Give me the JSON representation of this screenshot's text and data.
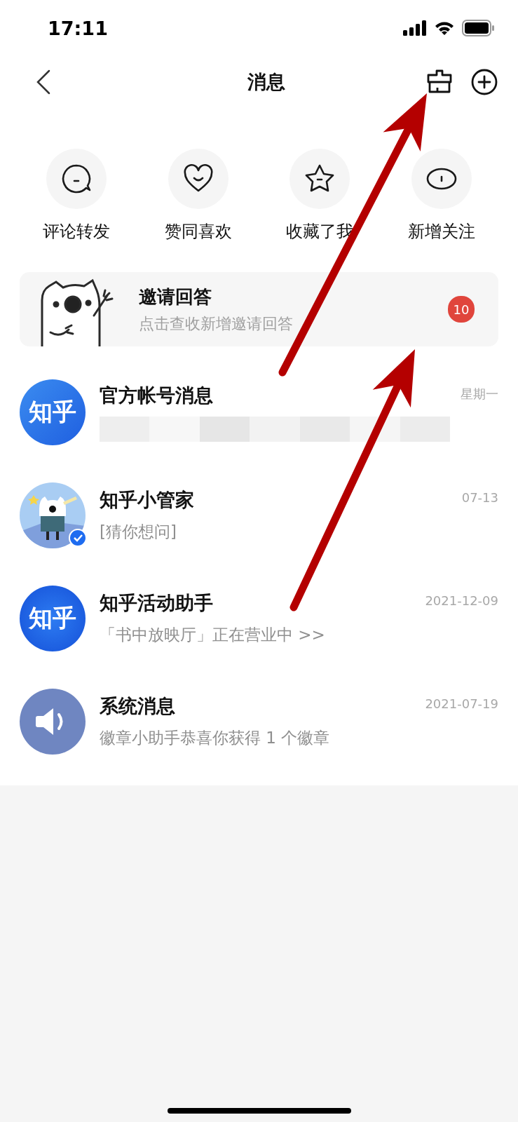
{
  "status_bar": {
    "time": "17:11"
  },
  "header": {
    "title": "消息"
  },
  "quick_actions": [
    {
      "kind": "comment",
      "label": "评论转发"
    },
    {
      "kind": "heart",
      "label": "赞同喜欢"
    },
    {
      "kind": "star",
      "label": "收藏了我"
    },
    {
      "kind": "follow",
      "label": "新增关注"
    }
  ],
  "invite_card": {
    "title": "邀请回答",
    "subtitle": "点击查收新增邀请回答",
    "badge": "10"
  },
  "conversations": [
    {
      "kind": "zhihu",
      "avatar_text": "知乎",
      "verified": false,
      "name": "官方帐号消息",
      "time": "星期一",
      "blurred": true
    },
    {
      "kind": "mascot",
      "verified": true,
      "name": "知乎小管家",
      "time": "07-13",
      "blurred": false,
      "preview": "[猜你想问]"
    },
    {
      "kind": "zhihu_event",
      "avatar_text": "知乎",
      "verified": false,
      "name": "知乎活动助手",
      "time": "2021-12-09",
      "blurred": false,
      "preview": "「书中放映厅」正在营业中 >>"
    },
    {
      "kind": "speaker",
      "verified": false,
      "name": "系统消息",
      "time": "2021-07-19",
      "blurred": false,
      "preview": "徽章小助手恭喜你获得 1 个徽章"
    }
  ]
}
